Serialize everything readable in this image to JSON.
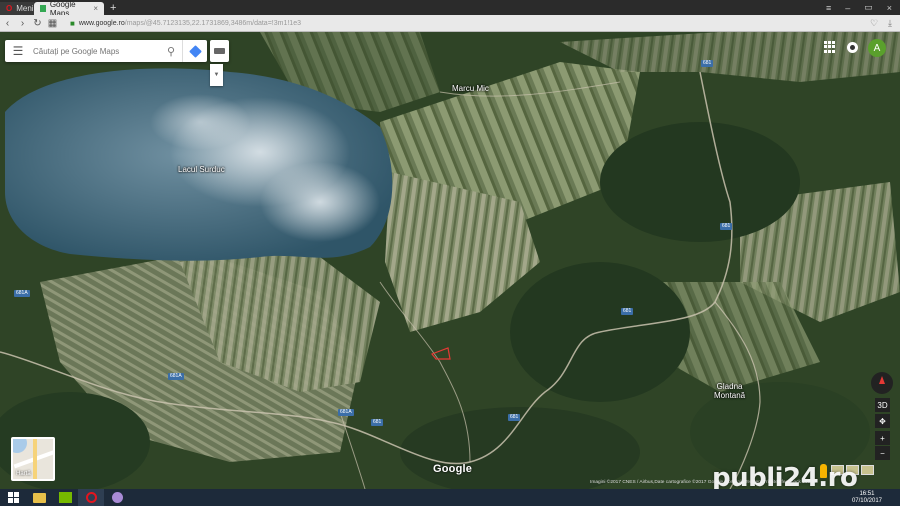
{
  "browser": {
    "menu_tab": "Meniu",
    "active_tab": "Google Maps",
    "new_tab": "+",
    "url_host": "www.google.ro",
    "url_path": "/maps/@45.7123135,22.1731869,3486m/data=!3m1!1e3"
  },
  "search": {
    "placeholder": "Căutați pe Google Maps"
  },
  "account": {
    "initial": "A"
  },
  "map": {
    "lake_label": "Lacul Surduc",
    "village_north": "Marcu Mic",
    "village_east": "Gladna\nMontană",
    "roads": [
      "681",
      "681",
      "681",
      "681A",
      "681A",
      "681",
      "681",
      "681A"
    ],
    "layer_label": "Hartă",
    "brand": "Google",
    "attribution": "Imagini ©2017 CNES / Airbus,Date cartografice ©2017 Google   România   Termeni   Trimiteți feedback   500 m",
    "controls": {
      "tilt": "3D",
      "zoom_in": "+",
      "zoom_out": "−"
    }
  },
  "watermark": "publi24.ro",
  "taskbar": {
    "time": "16:51",
    "date": "07/10/2017"
  },
  "colors": {
    "accent": "#4285f4",
    "avatar": "#5aa02c",
    "opera": "#e3151e",
    "taskbar": "#1d2a3a"
  }
}
